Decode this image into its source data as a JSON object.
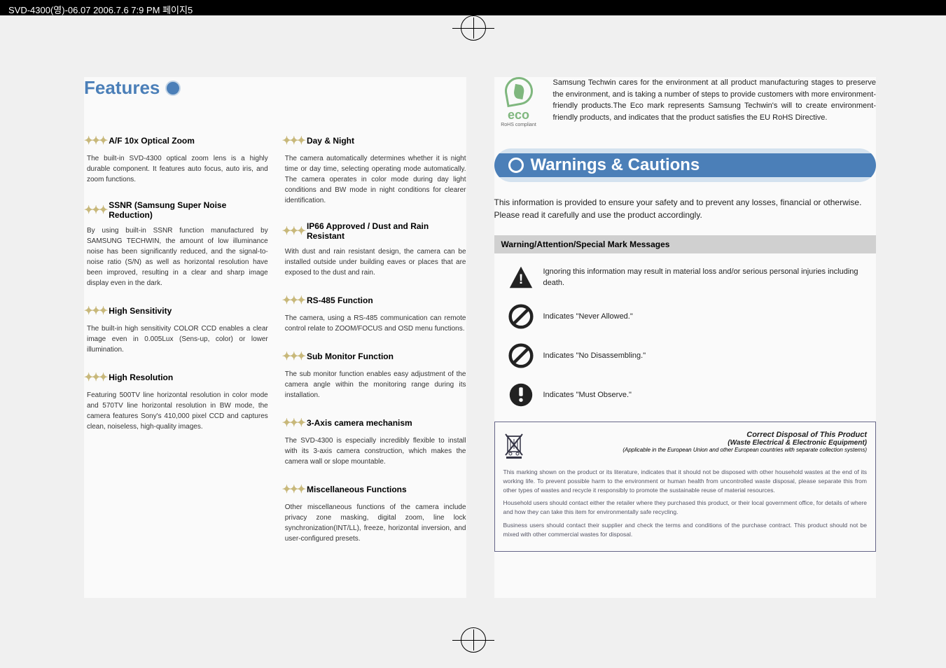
{
  "header_bar": "SVD-4300(영)-06.07  2006.7.6 7:9 PM  페이지5",
  "left": {
    "title": "Features",
    "col1": [
      {
        "h": "A/F 10x Optical Zoom",
        "b": "The built-in SVD-4300 optical zoom lens is a highly durable component. It features auto focus, auto iris, and zoom functions."
      },
      {
        "h": "SSNR (Samsung Super Noise Reduction)",
        "b": "By using built-in SSNR function manufactured by SAMSUNG TECHWIN, the amount of low illuminance noise has been significantly reduced, and the signal-to-noise ratio (S/N) as well as horizontal resolution have been improved, resulting in a clear and sharp image display even in the dark."
      },
      {
        "h": "High Sensitivity",
        "b": "The built-in high sensitivity COLOR CCD enables a clear image even in 0.005Lux (Sens-up, color) or lower illumination."
      },
      {
        "h": "High Resolution",
        "b": "Featuring 500TV line horizontal resolution in color mode and 570TV line horizontal resolution in BW mode, the camera features Sony's 410,000 pixel CCD and captures clean, noiseless, high-quality images."
      }
    ],
    "col2": [
      {
        "h": "Day & Night",
        "b": "The camera automatically determines whether it is night time or day time, selecting operating mode automatically. The camera operates in color mode during day light conditions and BW mode in night conditions for clearer identification."
      },
      {
        "h": "IP66 Approved / Dust and Rain Resistant",
        "b": "With dust and rain resistant design, the camera can be installed outside under building eaves or places that are exposed to the dust and rain."
      },
      {
        "h": "RS-485 Function",
        "b": "The camera, using a RS-485 communication can remote control relate to ZOOM/FOCUS and OSD menu  functions."
      },
      {
        "h": "Sub Monitor Function",
        "b": "The sub monitor function enables easy adjustment of the camera angle within the monitoring range during its installation."
      },
      {
        "h": "3-Axis camera mechanism",
        "b": "The SVD-4300 is especially incredibly flexible to install with its 3-axis camera construction, which makes the camera wall or slope mountable."
      },
      {
        "h": "Miscellaneous Functions",
        "b": "Other miscellaneous functions of the camera include privacy zone masking, digital zoom, line lock synchronization(INT/LL), freeze, horizontal inversion, and user-configured presets."
      }
    ]
  },
  "right": {
    "eco": {
      "label": "eco",
      "sub": "RoHS compliant",
      "desc": "Samsung Techwin cares for the environment at all product manufacturing stages to preserve the environment, and is taking a number of steps to provide customers with more environment-friendly products.The Eco mark represents Samsung Techwin's will to create environment-friendly products, and indicates that the product satisfies the EU RoHS Directive."
    },
    "banner": "Warnings & Cautions",
    "intro": "This information is provided to ensure your safety and to prevent any losses, financial or otherwise. Please read it carefully and use the product accordingly.",
    "subheader": "Warning/Attention/Special Mark Messages",
    "rows": [
      "Ignoring this information may result in material loss and/or serious personal injuries including death.",
      "Indicates \"Never Allowed.\"",
      "Indicates \"No Disassembling.\"",
      "Indicates \"Must Observe.\""
    ],
    "disposal": {
      "title": "Correct Disposal of This Product",
      "subtitle": "(Waste Electrical & Electronic Equipment)",
      "applicable": "(Applicable in the European Union and other European countries with separate collection systems)",
      "p1": "This marking shown on the product or its literature, indicates that it should not be disposed with other household wastes at the end of its working life. To prevent possible harm to the environment or human health from uncontrolled waste disposal, please separate this from other types of wastes and recycle it responsibly to promote the sustainable reuse of material resources.",
      "p2": "Household users should contact either the retailer where they purchased this product, or their local government office, for details of where and how they can take this item for environmentally safe recycling.",
      "p3": "Business users should contact their supplier and check the terms and conditions of the purchase contract. This product should not be mixed with other commercial wastes for disposal."
    }
  }
}
